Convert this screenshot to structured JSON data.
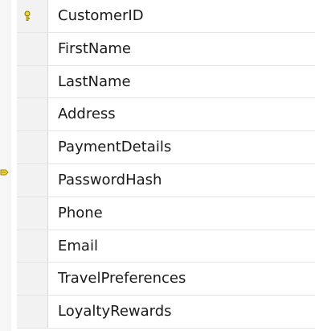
{
  "columns": [
    {
      "name": "CustomerID",
      "primary_key": true
    },
    {
      "name": "FirstName"
    },
    {
      "name": "LastName"
    },
    {
      "name": "Address"
    },
    {
      "name": "PaymentDetails"
    },
    {
      "name": "PasswordHash"
    },
    {
      "name": "Phone"
    },
    {
      "name": "Email"
    },
    {
      "name": "TravelPreferences"
    },
    {
      "name": "LoyaltyRewards"
    }
  ],
  "colors": {
    "key_icon": "#c8b400",
    "connector": "#e0c000",
    "grid_line": "#e4e4e4"
  },
  "icons": {
    "primary_key": "key-icon",
    "relationship": "relationship-connector-icon"
  }
}
